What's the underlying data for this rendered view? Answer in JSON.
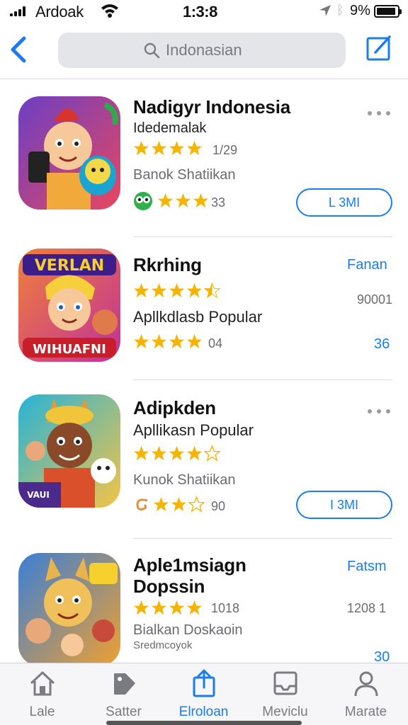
{
  "status_bar": {
    "carrier": "Ardoak",
    "time": "1:3:8",
    "battery": "9%"
  },
  "nav": {
    "search_placeholder": "Indonasian"
  },
  "results": [
    {
      "title": "Nadigyr Indonesia",
      "subtitle": "Idedemalak",
      "rating_count": "1/29",
      "developer": "Banok Shatiikan",
      "rating2_count": "33",
      "action_label": "L 3MI",
      "colors": {
        "bg1": "#6b3fc4",
        "bg2": "#e8475f"
      }
    },
    {
      "title": "Rkrhing",
      "category_link": "Fanan",
      "value": "90001",
      "subtitle": "Apllkdlasb Popular",
      "rating2_count": "04",
      "side_link": "36",
      "colors": {
        "bg1": "#f0803a",
        "bg2": "#c0309a"
      }
    },
    {
      "title": "Adipkden",
      "subtitle": "Apllikasn Popular",
      "developer": "Kunok Shatiikan",
      "rating2_count": "90",
      "action_label": "I 3MI",
      "colors": {
        "bg1": "#26b3d8",
        "bg2": "#f5c447"
      }
    },
    {
      "title_line1": "Aple1msiagn",
      "title_line2": "Dopssin",
      "category_link": "Fatsm",
      "rating_count": "1018",
      "value": "1208 1",
      "developer": "Bialkan Doskaoin",
      "extra": "Sredmcoyok",
      "side_link": "30",
      "colors": {
        "bg1": "#3a7fd6",
        "bg2": "#f0a030"
      }
    }
  ],
  "tabs": [
    {
      "label": "Lale",
      "icon": "house-icon"
    },
    {
      "label": "Satter",
      "icon": "tag-icon"
    },
    {
      "label": "Elroloan",
      "icon": "share-icon",
      "active": true
    },
    {
      "label": "Meviclu",
      "icon": "tray-icon"
    },
    {
      "label": "Marate",
      "icon": "person-icon"
    }
  ],
  "accent": "#1a7cf0",
  "star_color": "#f4b400"
}
